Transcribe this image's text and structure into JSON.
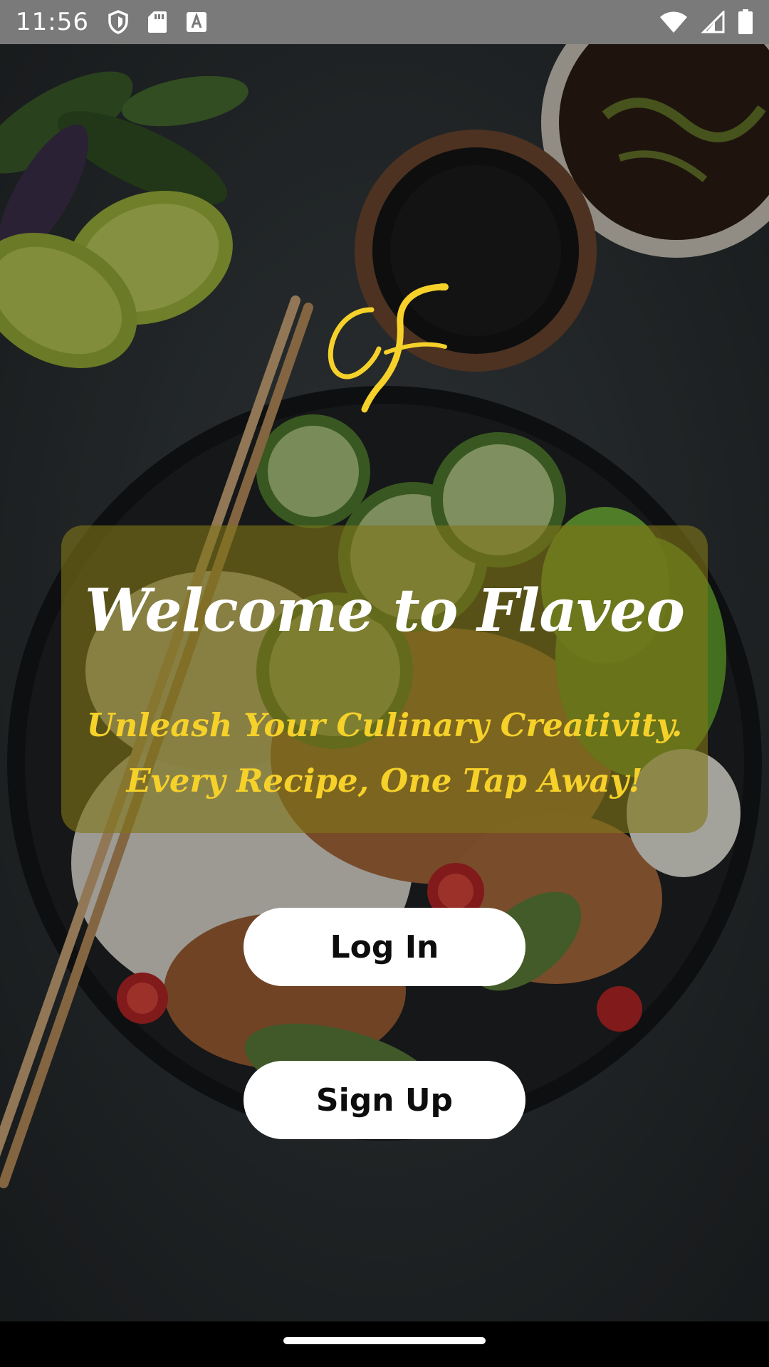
{
  "status_bar": {
    "time": "11:56",
    "left_icons": [
      "shield-icon",
      "sd-card-icon",
      "font-download-icon"
    ],
    "right_icons": [
      "wifi-icon",
      "cellular-signal-icon",
      "battery-icon"
    ]
  },
  "welcome": {
    "title": "Welcome to Flaveo",
    "tagline_line1": "Unleash Your Culinary Creativity.",
    "tagline_line2": "Every Recipe, One Tap Away!"
  },
  "actions": {
    "login_label": "Log In",
    "signup_label": "Sign Up"
  },
  "colors": {
    "accent_yellow": "#f6d12a",
    "card_overlay": "#807618",
    "button_bg": "#ffffff",
    "title_white": "#ffffff"
  }
}
